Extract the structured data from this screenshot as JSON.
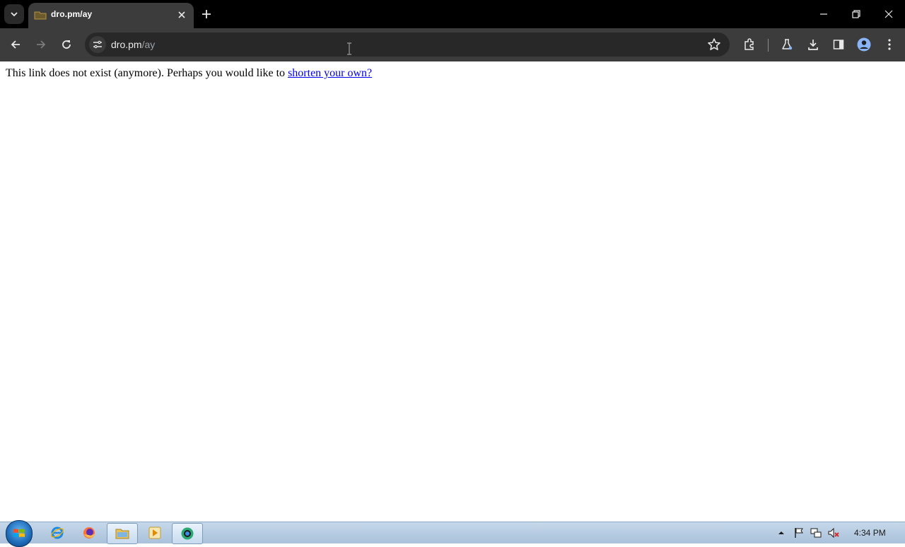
{
  "browser": {
    "tab": {
      "title": "dro.pm/ay"
    },
    "address": {
      "host": "dro.pm",
      "path": "/ay"
    }
  },
  "page": {
    "message": "This link does not exist (anymore). Perhaps you would like to ",
    "link_text": "shorten your own?"
  },
  "taskbar": {
    "clock": "4:34 PM",
    "apps": [
      "internet-explorer",
      "firefox",
      "file-explorer",
      "media-player",
      "chrome"
    ]
  }
}
